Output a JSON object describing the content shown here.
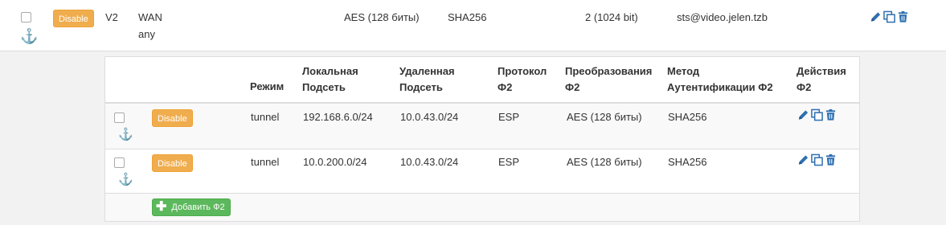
{
  "phase1": {
    "disable_label": "Disable",
    "version": "V2",
    "interface": "WAN",
    "remote": "any",
    "encryption": "AES (128 биты)",
    "hash": "SHA256",
    "dh_group": "2 (1024 bit)",
    "description": "sts@video.jelen.tzb"
  },
  "phase2": {
    "headers": {
      "mode": "Режим",
      "local_line1": "Локальная",
      "local_line2": "Подсеть",
      "remote_line1": "Удаленная",
      "remote_line2": "Подсеть",
      "proto_line1": "Протокол",
      "proto_line2": "Ф2",
      "trans_line1": "Преобразования",
      "trans_line2": "Ф2",
      "auth_line1": "Метод",
      "auth_line2": "Аутентификации Ф2",
      "actions_line1": "Действия",
      "actions_line2": "Ф2"
    },
    "rows": [
      {
        "disable_label": "Disable",
        "mode": "tunnel",
        "local": "192.168.6.0/24",
        "remote": "10.0.43.0/24",
        "protocol": "ESP",
        "transform": "AES (128 биты)",
        "auth": "SHA256"
      },
      {
        "disable_label": "Disable",
        "mode": "tunnel",
        "local": "10.0.200.0/24",
        "remote": "10.0.43.0/24",
        "protocol": "ESP",
        "transform": "AES (128 биты)",
        "auth": "SHA256"
      }
    ],
    "add_label": "Добавить Ф2"
  },
  "icons": [
    "anchor-icon",
    "pencil-icon",
    "clone-icon",
    "trash-icon",
    "plus-icon"
  ],
  "colors": {
    "disable": "#f0ad4e",
    "add": "#5cb85c",
    "icon": "#2f6fb0"
  }
}
